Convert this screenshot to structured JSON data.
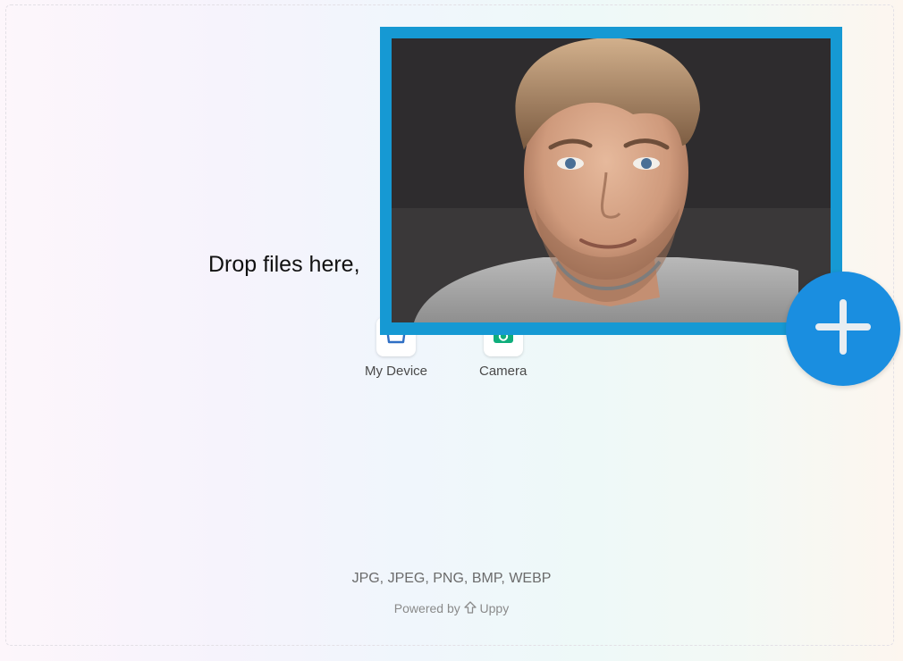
{
  "dropzone": {
    "prompt": "Drop files here,"
  },
  "sources": [
    {
      "label": "My Device",
      "icon": "device-icon"
    },
    {
      "label": "Camera",
      "icon": "camera-icon"
    }
  ],
  "footer": {
    "formats": "JPG, JPEG, PNG, BMP, WEBP",
    "powered_prefix": "Powered by",
    "brand": "Uppy"
  },
  "photo": {
    "description_icon": "selfie-photo",
    "frame_color": "#1699d3"
  },
  "fab": {
    "icon": "plus-icon",
    "color": "#1a8ee0"
  }
}
